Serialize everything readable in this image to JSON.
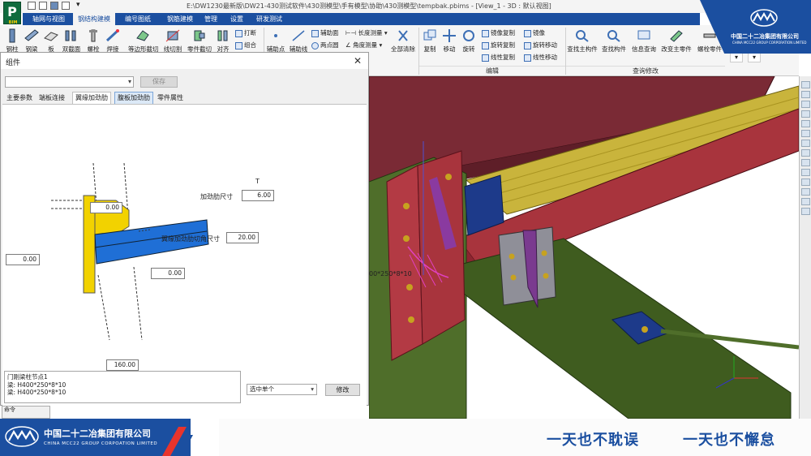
{
  "titlebar": {
    "path": "E:\\DW1230最新版\\DW21-430测试软件\\430测模型\\手有模型\\协助\\430测模型\\tempbak.pbims - [View_1 - 3D : 默认视图]",
    "app_icon": "P",
    "app_icon_sub": "BIM"
  },
  "menu": {
    "items": [
      "轴网与视图",
      "钢结构建模",
      "编号图纸",
      "钢筋建模",
      "管理",
      "设置",
      "研发测试"
    ],
    "active": "钢结构建模"
  },
  "ribbon": {
    "big_buttons": [
      "钢柱",
      "钢梁",
      "板",
      "双截面",
      "螺栓",
      "焊接",
      "等边形截切",
      "线切割",
      "零件截切",
      "对齐"
    ],
    "small_col1": [
      "打断",
      "组合"
    ],
    "point_buttons": [
      "辅助点",
      "辅助线"
    ],
    "small_col2": [
      "辅助面",
      "两点圆"
    ],
    "measure": [
      "长度测量",
      "角度测量"
    ],
    "clear_all": "全部清除",
    "edit_big": [
      "复制",
      "移动",
      "旋转"
    ],
    "edit_small_a": [
      "镜像复制",
      "旋转复制",
      "线性复制"
    ],
    "edit_small_b": [
      "镜像",
      "旋转移动",
      "线性移动"
    ],
    "query_buttons": [
      "查找主构件",
      "查找构件",
      "信息查询",
      "改变主零件",
      "螺栓零件"
    ],
    "groups": {
      "edit": "编辑",
      "query": "查询修改"
    }
  },
  "logo_top": {
    "cn": "中国二十二冶集团有限公司",
    "en": "CHINA MCC22 GROUP CORPORATION LIMITED"
  },
  "dialog": {
    "title": "组件",
    "save_label": "保存",
    "tabs": [
      "主要参数",
      "端板连接",
      "翼缘加劲肋",
      "腹板加劲肋",
      "零件属性"
    ],
    "active_tab": "翼缘加劲肋",
    "hover_tab": "腹板加劲肋",
    "unit": "T",
    "stiffener_size_label": "加劲肋尺寸",
    "stiffener_size_value": "6.00",
    "corner_cut_label": "翼缘加劲肋切角尺寸",
    "corner_cut_value": "20.00",
    "field_top": "0.00",
    "field_left": "0.00",
    "field_mid": "0.00",
    "field_bottom": "160.00",
    "info_lines": [
      "门刚梁柱节点1",
      "梁: H400*250*8*10",
      "梁: H400*250*8*10"
    ],
    "select_mode": "选中单个",
    "modify_label": "修改",
    "below_text": "命令"
  },
  "viewport": {
    "dim_label": "00*250*8*10"
  },
  "banner": {
    "cn": "中国二十二冶集团有限公司",
    "en": "CHINA MCC22 GROUP CORPOATION LIMITED",
    "slogan1": "一天也不耽误",
    "slogan2": "一天也不懈怠"
  },
  "colors": {
    "brand": "#1b4fa0",
    "beam_red": "#8b2a34",
    "beam_green": "#4b6b2a",
    "beam_yellow": "#c8b13a",
    "plate_blue": "#1d3a8a",
    "stiffener_purple": "#7a3a8f"
  }
}
